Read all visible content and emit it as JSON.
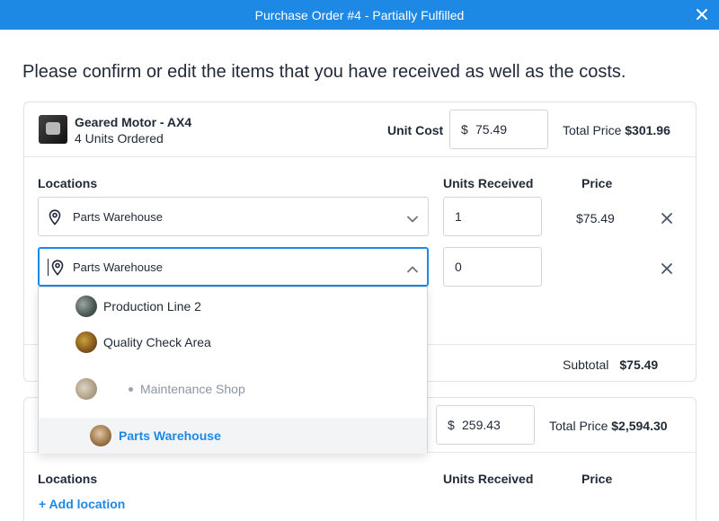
{
  "modal": {
    "title": "Purchase Order #4 - Partially Fulfilled",
    "prompt": "Please confirm or edit the items that you have received as well as the costs."
  },
  "item1": {
    "name": "Geared Motor - AX4",
    "ordered": "4 Units Ordered",
    "unit_cost_label": "Unit Cost",
    "currency": "$",
    "unit_cost": "75.49",
    "total_price_label": "Total Price",
    "total_price": "$301.96",
    "headers": {
      "locations": "Locations",
      "units_received": "Units Received",
      "price": "Price"
    },
    "rows": [
      {
        "location": "Parts Warehouse",
        "units": "1",
        "price": "$75.49"
      },
      {
        "location": "Parts Warehouse",
        "units": "0",
        "price": ""
      }
    ],
    "subtotal_label": "Subtotal",
    "subtotal": "$75.49"
  },
  "dropdown": {
    "options": [
      {
        "label": "Production Line 2",
        "state": "normal"
      },
      {
        "label": "Quality Check Area",
        "state": "normal"
      },
      {
        "label": "Maintenance Shop",
        "state": "disabled"
      },
      {
        "label": "Parts Warehouse",
        "state": "selected"
      }
    ]
  },
  "item2": {
    "currency": "$",
    "unit_cost": "259.43",
    "total_price_label": "Total Price",
    "total_price": "$2,594.30",
    "headers": {
      "locations": "Locations",
      "units_received": "Units Received",
      "price": "Price"
    },
    "add_location": "+ Add location"
  },
  "colors": {
    "accent": "#1e88e5",
    "border": "#d1d5db",
    "text": "#1f2937",
    "muted": "#8b95a3"
  },
  "icons": [
    "close-icon",
    "location-pin-icon",
    "chevron-down-icon",
    "chevron-up-icon",
    "remove-icon"
  ]
}
